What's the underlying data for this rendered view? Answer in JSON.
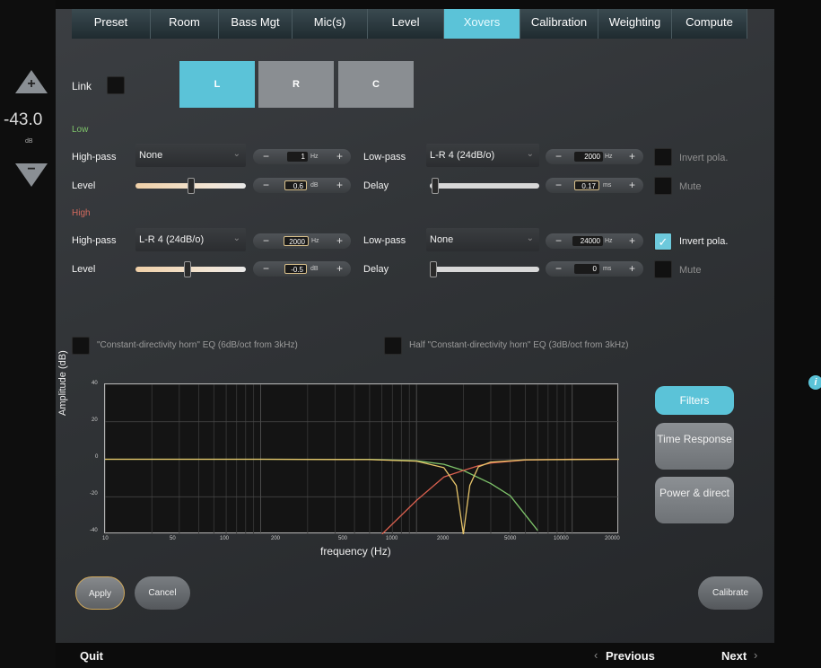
{
  "tabs": [
    "Preset",
    "Room",
    "Bass Mgt",
    "Mic(s)",
    "Level",
    "Xovers",
    "Calibration",
    "Weighting",
    "Compute"
  ],
  "active_tab": "Xovers",
  "volume": {
    "value": "-43.0",
    "unit": "dB",
    "up_symbol": "+",
    "down_symbol": "−"
  },
  "link": {
    "label": "Link",
    "checked": false
  },
  "channels": {
    "items": [
      "L",
      "R",
      "C"
    ],
    "selected": "L"
  },
  "low": {
    "section_label": "Low",
    "highpass": {
      "label": "High-pass",
      "type": "None",
      "freq": "1",
      "unit": "Hz"
    },
    "lowpass": {
      "label": "Low-pass",
      "type": "L-R 4 (24dB/o)",
      "freq": "2000",
      "unit": "Hz"
    },
    "level": {
      "label": "Level",
      "value": "0.6",
      "unit": "dB",
      "slider_fraction": 0.5
    },
    "delay": {
      "label": "Delay",
      "value": "0.17",
      "unit": "ms",
      "slider_fraction": 0.02
    },
    "invert": {
      "label": "Invert pola.",
      "checked": false
    },
    "mute": {
      "label": "Mute",
      "checked": false
    }
  },
  "high": {
    "section_label": "High",
    "highpass": {
      "label": "High-pass",
      "type": "L-R 4 (24dB/o)",
      "freq": "2000",
      "unit": "Hz"
    },
    "lowpass": {
      "label": "Low-pass",
      "type": "None",
      "freq": "24000",
      "unit": "Hz"
    },
    "level": {
      "label": "Level",
      "value": "-0.5",
      "unit": "dB",
      "slider_fraction": 0.47
    },
    "delay": {
      "label": "Delay",
      "value": "0",
      "unit": "ms",
      "slider_fraction": 0.0
    },
    "invert": {
      "label": "Invert pola.",
      "checked": true
    },
    "mute": {
      "label": "Mute",
      "checked": false
    }
  },
  "cdh_eq": {
    "label": "\"Constant-directivity horn\" EQ (6dB/oct from 3kHz)",
    "checked": false
  },
  "half_cdh_eq": {
    "label": "Half \"Constant-directivity horn\" EQ (3dB/oct from 3kHz)",
    "checked": false
  },
  "chart_data": {
    "type": "line",
    "xlabel": "frequency (Hz)",
    "ylabel": "Amplitude (dB)",
    "x_scale": "log",
    "xlim": [
      10,
      20000
    ],
    "ylim": [
      -40,
      40
    ],
    "x_ticks": [
      "10",
      "50",
      "100",
      "200",
      "500",
      "1000",
      "2000",
      "5000",
      "10000",
      "20000"
    ],
    "y_ticks": [
      "40",
      "20",
      "0",
      "-20",
      "-40"
    ],
    "grid": true,
    "series": [
      {
        "color": "#7ec36a",
        "x": [
          10,
          100,
          500,
          1000,
          1500,
          2000,
          3000,
          4000,
          6000
        ],
        "y": [
          0,
          0,
          -0.1,
          -0.8,
          -2.7,
          -6.0,
          -13.0,
          -19.5,
          -38.0
        ]
      },
      {
        "color": "#d9604f",
        "x": [
          600,
          1000,
          1500,
          2000,
          2500,
          3000,
          5000,
          10000,
          20000
        ],
        "y": [
          -40,
          -22.0,
          -9.5,
          -6.0,
          -3.5,
          -2.0,
          -0.4,
          0,
          0
        ]
      },
      {
        "color": "#e6c46a",
        "x": [
          10,
          100,
          500,
          1000,
          1500,
          1800,
          2000,
          2200,
          2500,
          3000,
          5000,
          20000
        ],
        "y": [
          0,
          0,
          -0.2,
          -1.0,
          -4.5,
          -14.0,
          -40.0,
          -14.0,
          -4.0,
          -1.5,
          -0.3,
          0
        ]
      }
    ]
  },
  "view_buttons": {
    "filters": "Filters",
    "time_response": "Time Response",
    "power": "Power & direct",
    "active": "Filters"
  },
  "buttons": {
    "apply": "Apply",
    "cancel": "Cancel",
    "calibrate": "Calibrate"
  },
  "footer": {
    "quit": "Quit",
    "previous": "Previous",
    "next": "Next",
    "prev_chev": "‹",
    "next_chev": "›"
  },
  "info_icon_glyph": "i"
}
